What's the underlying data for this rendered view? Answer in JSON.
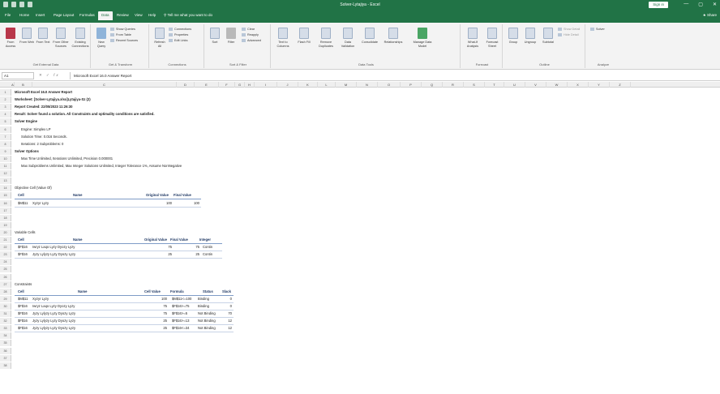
{
  "titlebar": {
    "doc_title": "Solver-Lytajiya - Excel",
    "signin": "Sign in",
    "window_controls": [
      "—",
      "▢",
      "✕"
    ]
  },
  "tabs": [
    "File",
    "Home",
    "Insert",
    "Page Layout",
    "Formulas",
    "Data",
    "Review",
    "View",
    "Help",
    "Tell me what you want to do"
  ],
  "active_tab": "Data",
  "share": "Share",
  "ribbon": {
    "groups": [
      {
        "label": "Get External Data",
        "buttons": [
          "From Access",
          "From Web",
          "From Text",
          "From Other Sources",
          "Existing Connections"
        ]
      },
      {
        "label": "Get & Transform",
        "buttons": [
          "New Query"
        ],
        "small": [
          "Show Queries",
          "From Table",
          "Recent Sources"
        ]
      },
      {
        "label": "Connections",
        "buttons": [
          "Refresh All"
        ],
        "small": [
          "Connections",
          "Properties",
          "Edit Links"
        ]
      },
      {
        "label": "Sort & Filter",
        "buttons": [
          "Sort",
          "Filter"
        ],
        "small": [
          "Clear",
          "Reapply",
          "Advanced"
        ]
      },
      {
        "label": "Data Tools",
        "buttons": [
          "Text to Columns",
          "Flash Fill",
          "Remove Duplicates",
          "Data Validation",
          "Consolidate",
          "Relationships",
          "Manage Data Model"
        ]
      },
      {
        "label": "Forecast",
        "buttons": [
          "What-If Analysis",
          "Forecast Sheet"
        ]
      },
      {
        "label": "Outline",
        "buttons": [
          "Group",
          "Ungroup",
          "Subtotal"
        ],
        "small": [
          "Show Detail",
          "Hide Detail"
        ]
      },
      {
        "label": "Analyze",
        "small": [
          "Solver"
        ]
      }
    ]
  },
  "formula_bar": {
    "name_box": "A1",
    "content": "Microsoft Excel 16.0 Answer Report"
  },
  "columns": [
    "A",
    "B",
    "C",
    "D",
    "E",
    "F",
    "G",
    "H",
    "I",
    "J",
    "K",
    "L",
    "M",
    "N",
    "O",
    "P",
    "Q",
    "R",
    "S",
    "T",
    "U",
    "V",
    "W",
    "X",
    "Y",
    "Z"
  ],
  "report": {
    "line1": "Microsoft Excel 16.0 Answer Report",
    "line2": "Worksheet: [Solver-Lytajiya.xlsx]Lytajiya-Sz (2)",
    "line3": "Report Created: 22/05/2023 11:26:30",
    "line4": "Result: Solver found a solution. All Constraints and optimality conditions are satisfied.",
    "engine_header": "Solver Engine",
    "engine": "Engine: Simplex LP",
    "time": "Solution Time: 0.016 Seconds.",
    "iterations": "Iterations: 2 Subproblems: 0",
    "options_header": "Solver Options",
    "options1": "Max Time Unlimited,  Iterations Unlimited, Precision 0.000001",
    "options2": "Max Subproblems Unlimited, Max Integer Solutions Unlimited, Integer Tolerance 1%, Assume NonNegative"
  },
  "objective": {
    "title": "Objective Cell (Value Of)",
    "headers": [
      "Cell",
      "Name",
      "Original Value",
      "Final Value"
    ],
    "rows": [
      [
        "$M$11",
        "Xyzyr Lyzy",
        "100",
        "100"
      ]
    ]
  },
  "variables": {
    "title": "Variable Cells",
    "headers": [
      "Cell",
      "Name",
      "Original Value",
      "Final Value",
      "Integer"
    ],
    "rows": [
      [
        "$F$16",
        "Iwryz Laqo Lyzy Dyozy Lyzy",
        "75",
        "75",
        "Contin"
      ],
      [
        "$F$16",
        "Jyzy Lylyzy Lyzy Dyozy Lyzy",
        "25",
        "25",
        "Contin"
      ]
    ]
  },
  "constraints": {
    "title": "Constraints",
    "headers": [
      "Cell",
      "Name",
      "Cell Value",
      "Formula",
      "Status",
      "Slack"
    ],
    "rows": [
      [
        "$M$11",
        "Xyzyr Lyzy",
        "100",
        "$M$11<=100",
        "Binding",
        "0"
      ],
      [
        "$F$16",
        "Iwryz Laqo Lyzy Dyozy Lyzy",
        "75",
        "$F$16>=75",
        "Binding",
        "0"
      ],
      [
        "$F$16",
        "Jyzy Lylyzy Lyzy Dyozy Lyzy",
        "75",
        "$F$16>=5",
        "Not Binding",
        "70"
      ],
      [
        "$F$16",
        "Jyzy Lylyzy Lyzy Dyozy Lyzy",
        "25",
        "$F$16>=13",
        "Not Binding",
        "12"
      ],
      [
        "$F$16",
        "Jyzy Lylyzy Lyzy Dyozy Lyzy",
        "25",
        "$F$16<=34",
        "Not Binding",
        "12"
      ]
    ]
  },
  "colors": {
    "excel_green": "#217346",
    "table_header_text": "#1f3864",
    "rule": "#7f9cc7"
  }
}
